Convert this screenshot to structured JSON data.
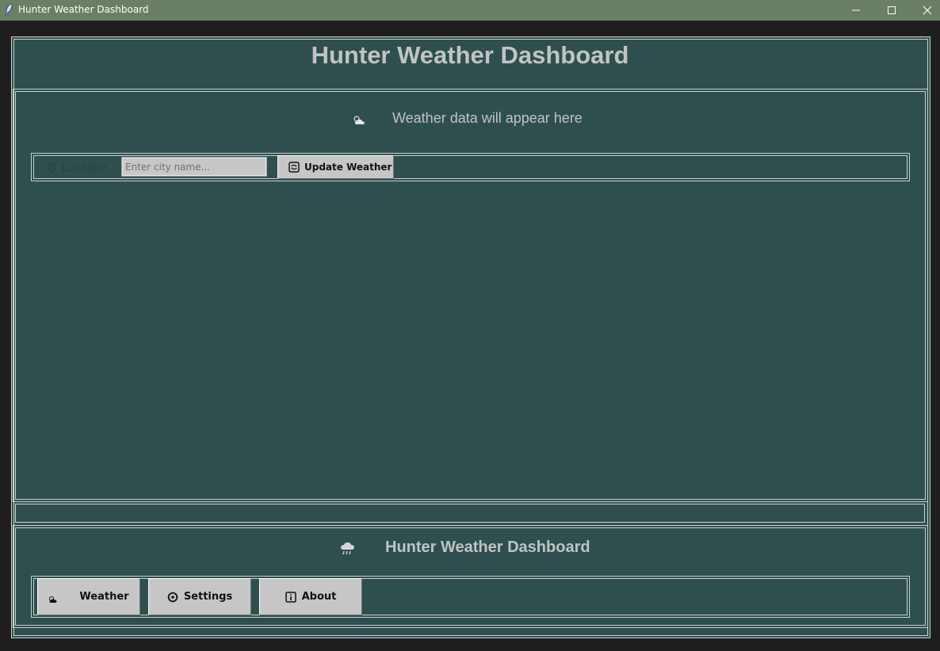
{
  "window": {
    "title": "Hunter Weather Dashboard"
  },
  "header": {
    "title": "Hunter Weather Dashboard"
  },
  "main": {
    "weather_message": "Weather data will appear here",
    "location_label": "Location",
    "city_placeholder": "Enter city name...",
    "update_button": "Update Weather"
  },
  "footer": {
    "title": "Hunter Weather Dashboard",
    "nav": {
      "weather": "Weather",
      "settings": "Settings",
      "about": "About"
    }
  },
  "colors": {
    "titlebar": "#6a7f63",
    "panel": "#2f4f4f",
    "text": "#c0c4c2",
    "button": "#c6c6c6"
  }
}
